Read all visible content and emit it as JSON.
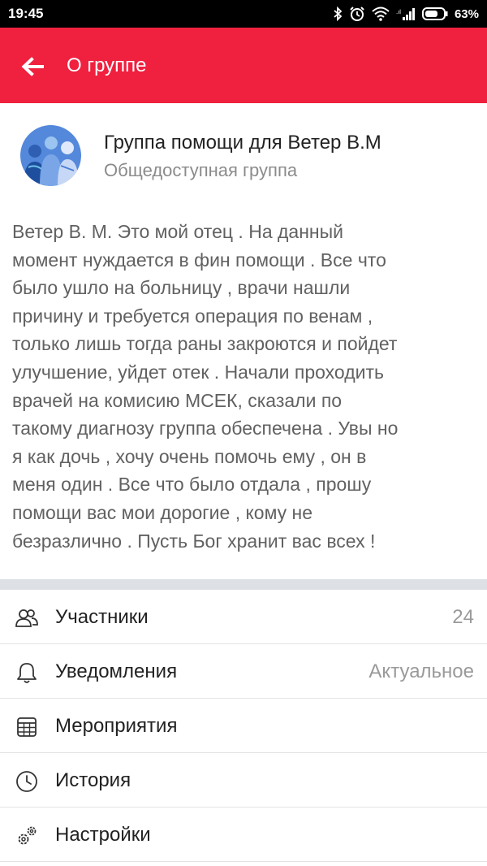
{
  "status_bar": {
    "time": "19:45",
    "battery_percent": "63%",
    "icons": [
      "bluetooth-icon",
      "alarm-icon",
      "wifi-icon",
      "signal-icon",
      "battery-icon"
    ]
  },
  "app_bar": {
    "title": "О группе",
    "back_icon": "arrow-left-icon",
    "color": "#f0203f"
  },
  "group": {
    "name": "Группа помощи для  Ветер В.М",
    "type": "Общедоступная группа",
    "description_lines": [
      "Ветер В. М. Это мой отец . На данный",
      "момент нуждается в фин помощи . Все что",
      "было ушло на больницу , врачи нашли",
      "причину и требуется операция по венам ,",
      "только лишь тогда раны закроются и пойдет",
      "улучшение, уйдет отек . Начали проходить",
      "врачей на комисию МСЕК, сказали по",
      "такому диагнозу группа обеспечена . Увы но",
      "я как дочь , хочу очень помочь ему , он в",
      "меня один . Все что было отдала , прошу",
      "помощи вас мои дорогие , кому не",
      "безразлично . Пусть Бог хранит вас всех !"
    ]
  },
  "menu": [
    {
      "label": "Участники",
      "value": "24",
      "icon": "members-icon"
    },
    {
      "label": "Уведомления",
      "value": "Актуальное",
      "icon": "bell-icon"
    },
    {
      "label": "Мероприятия",
      "value": "",
      "icon": "calendar-icon"
    },
    {
      "label": "История",
      "value": "",
      "icon": "clock-icon"
    },
    {
      "label": "Настройки",
      "value": "",
      "icon": "gears-icon"
    }
  ]
}
